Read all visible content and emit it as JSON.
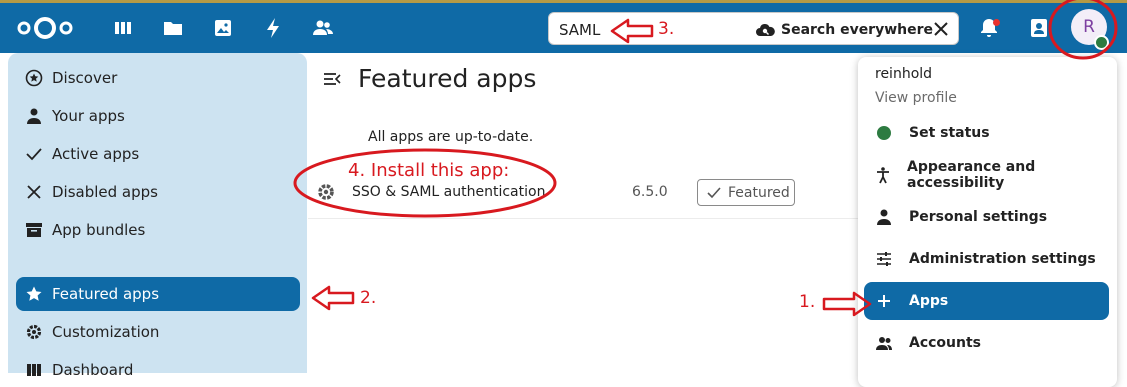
{
  "header": {
    "search_value": "SAML",
    "search_scope_label": "Search everywhere",
    "avatar_initial": "R"
  },
  "sidebar": {
    "items": [
      {
        "label": "Discover",
        "icon": "star-circle-icon"
      },
      {
        "label": "Your apps",
        "icon": "person-icon"
      },
      {
        "label": "Active apps",
        "icon": "check-icon"
      },
      {
        "label": "Disabled apps",
        "icon": "close-icon"
      },
      {
        "label": "App bundles",
        "icon": "archive-icon"
      },
      {
        "label": "Featured apps",
        "icon": "star-icon",
        "active": true
      },
      {
        "label": "Customization",
        "icon": "gear-icon"
      },
      {
        "label": "Dashboard",
        "icon": "dashboard-icon"
      }
    ]
  },
  "main": {
    "title": "Featured apps",
    "status_text": "All apps are up-to-date.",
    "apps": [
      {
        "name": "SSO & SAML authentication",
        "version": "6.5.0",
        "badge": "Featured"
      }
    ]
  },
  "user_menu": {
    "username": "reinhold",
    "view_profile": "View profile",
    "items": [
      {
        "label": "Set status",
        "icon": "status-dot-icon"
      },
      {
        "label": "Appearance and accessibility",
        "icon": "accessibility-icon"
      },
      {
        "label": "Personal settings",
        "icon": "person-icon"
      },
      {
        "label": "Administration settings",
        "icon": "tune-icon"
      },
      {
        "label": "Apps",
        "icon": "plus-icon",
        "active": true
      },
      {
        "label": "Accounts",
        "icon": "accounts-icon"
      }
    ]
  },
  "annotations": {
    "step1": "1.",
    "step2": "2.",
    "step3": "3.",
    "step4": "4. Install this app:"
  },
  "colors": {
    "header_bg": "#0f6aa6",
    "sidebar_bg": "#cde3f1",
    "active_bg": "#0f6aa6",
    "annotation": "#d8191f",
    "status_online": "#2d7b41"
  }
}
